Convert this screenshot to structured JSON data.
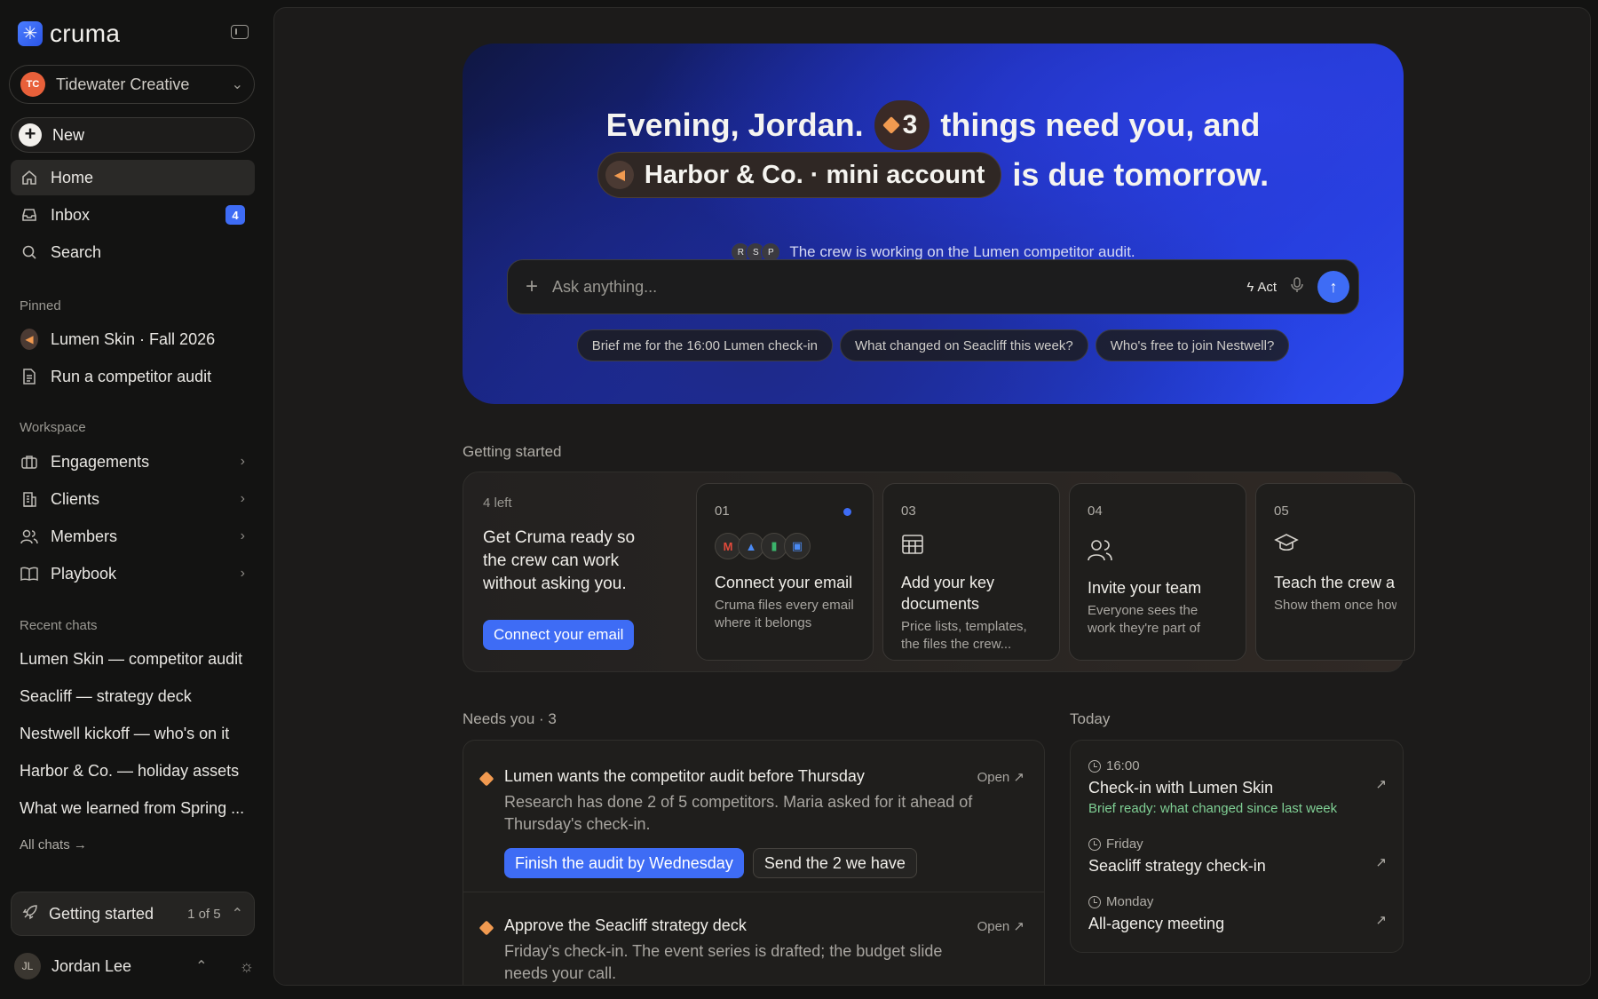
{
  "brand": {
    "name": "cruma"
  },
  "org": {
    "initials": "TC",
    "name": "Tidewater Creative"
  },
  "sidebar": {
    "new_label": "New",
    "nav": [
      {
        "label": "Home",
        "icon": "home-icon"
      },
      {
        "label": "Inbox",
        "icon": "inbox-icon",
        "badge": "4"
      },
      {
        "label": "Search",
        "icon": "search-icon"
      }
    ],
    "pinned_label": "Pinned",
    "pinned": [
      {
        "label": "Lumen Skin · Fall 2026",
        "icon": "megaphone-icon"
      },
      {
        "label": "Run a competitor audit",
        "icon": "document-icon"
      }
    ],
    "workspace_label": "Workspace",
    "workspace": [
      {
        "label": "Engagements",
        "icon": "briefcase-icon"
      },
      {
        "label": "Clients",
        "icon": "building-icon"
      },
      {
        "label": "Members",
        "icon": "users-icon"
      },
      {
        "label": "Playbook",
        "icon": "book-icon"
      }
    ],
    "recent_label": "Recent chats",
    "recent": [
      "Lumen Skin — competitor audit",
      "Seacliff — strategy deck",
      "Nestwell kickoff — who's on it",
      "Harbor & Co. — holiday assets",
      "What we learned from Spring ..."
    ],
    "all_chats": "All chats →",
    "getting_started": {
      "label": "Getting started",
      "count": "1 of 5"
    },
    "user": {
      "initials": "JL",
      "name": "Jordan Lee"
    }
  },
  "hero": {
    "line1_a": "Evening, Jordan.",
    "count": "3",
    "line1_b": "things need you, and",
    "account": "Harbor & Co. · mini account",
    "line2_b": "is due tomorrow.",
    "crew_avatars": [
      "R",
      "S",
      "P"
    ],
    "crew_text": "The crew is working on the Lumen competitor audit.",
    "ask_placeholder": "Ask anything...",
    "act_label": "Act",
    "suggestions": [
      "Brief me for the 16:00 Lumen check-in",
      "What changed on Seacliff this week?",
      "Who's free to join Nestwell?"
    ]
  },
  "getting_started": {
    "heading": "Getting started",
    "left": "4 left",
    "title": "Get Cruma ready so the crew can work without asking you.",
    "cta": "Connect your email",
    "steps": [
      {
        "num": "01",
        "title": "Connect your email",
        "desc": "Cruma files every email where it belongs",
        "icons": [
          "M",
          "▲",
          "▮",
          "▣"
        ]
      },
      {
        "num": "03",
        "title": "Add your key documents",
        "desc": "Price lists, templates, the files the crew...",
        "icon": "table-icon"
      },
      {
        "num": "04",
        "title": "Invite your team",
        "desc": "Everyone sees the work they're part of",
        "icon": "users-icon"
      },
      {
        "num": "05",
        "title": "Teach the crew a skill",
        "desc": "Show them once how you do something",
        "icon": "graduation-cap-icon"
      }
    ]
  },
  "needs": {
    "heading": "Needs you",
    "count": "· 3",
    "items": [
      {
        "title": "Lumen wants the competitor audit before Thursday",
        "open": "Open ↗",
        "desc": "Research has done 2 of 5 competitors. Maria asked for it ahead of Thursday's check-in.",
        "primary": "Finish the audit by Wednesday",
        "secondary": "Send the 2 we have"
      },
      {
        "title": "Approve the Seacliff strategy deck",
        "open": "Open ↗",
        "desc": "Friday's check-in. The event series is drafted; the budget slide needs your call."
      }
    ]
  },
  "today": {
    "heading": "Today",
    "items": [
      {
        "time": "16:00",
        "title": "Check-in with Lumen Skin",
        "note": "Brief ready: what changed since last week"
      },
      {
        "time": "Friday",
        "title": "Seacliff strategy check-in"
      },
      {
        "time": "Monday",
        "title": "All-agency meeting"
      }
    ]
  }
}
